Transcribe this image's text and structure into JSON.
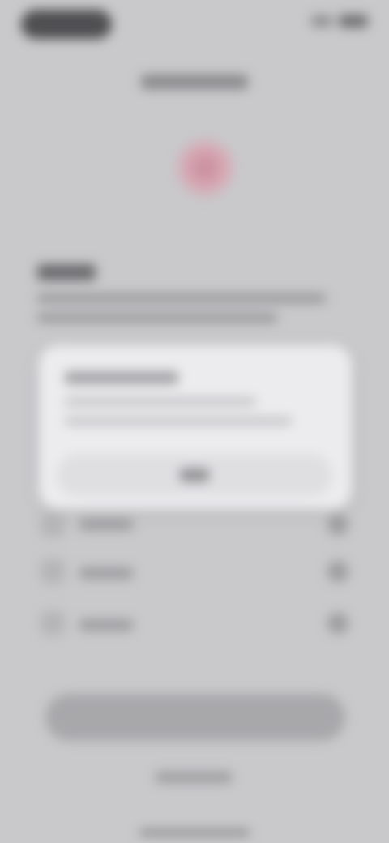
{
  "screen": {
    "state": "blurred_overlay",
    "status_bar": {
      "icons": [
        "signal-icon",
        "battery-icon"
      ]
    },
    "nav": {
      "title": ""
    },
    "hero": {
      "icon": "hero-icon"
    },
    "section": {
      "heading": "",
      "paragraph": ""
    },
    "alert": {
      "title": "",
      "body": "",
      "button_label": ""
    },
    "list": {
      "items": [
        {
          "label": "",
          "end_icon": "chevron-icon"
        },
        {
          "label": "",
          "end_icon": "chevron-icon"
        },
        {
          "label": "",
          "end_icon": "chevron-icon"
        }
      ]
    },
    "primary_button": {
      "label": ""
    },
    "secondary_link": {
      "label": ""
    }
  }
}
